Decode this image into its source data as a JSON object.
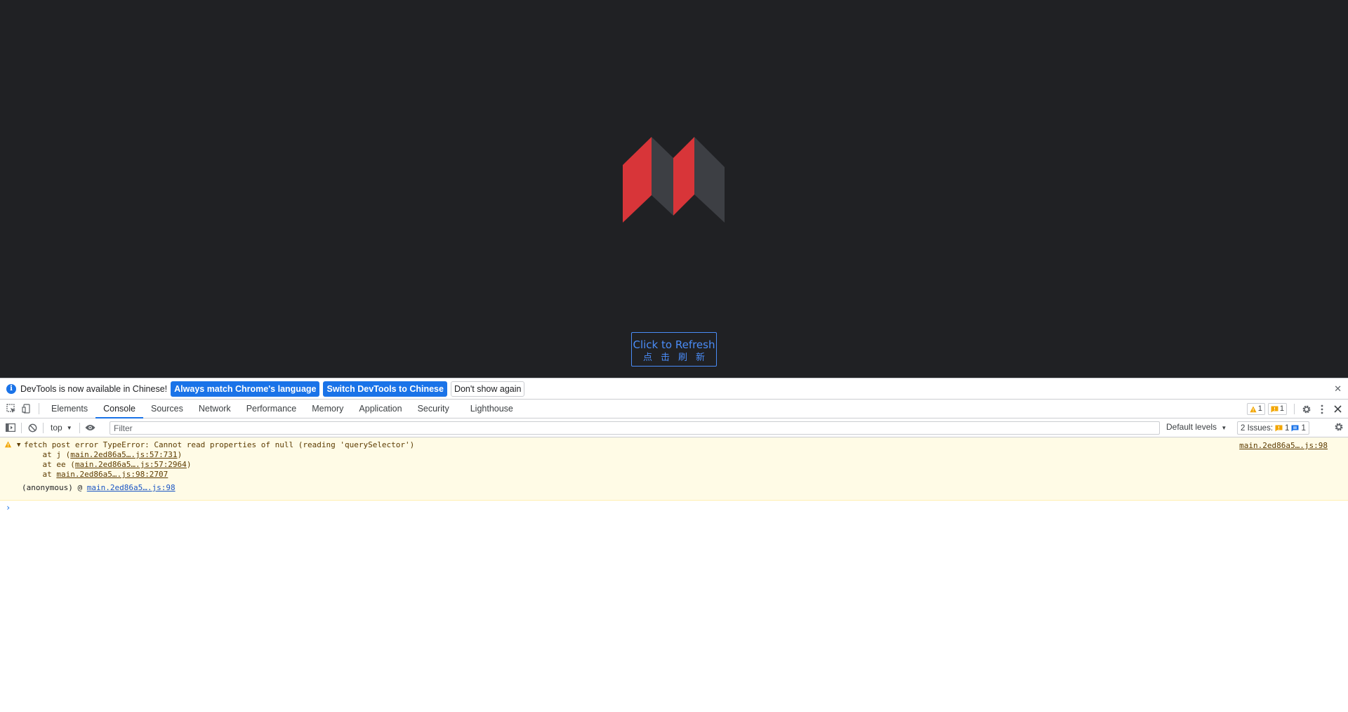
{
  "page": {
    "refresh_button": {
      "label_en": "Click to Refresh",
      "label_zh": "点击刷新"
    },
    "colors": {
      "background": "#202124",
      "logo_red": "#d83539",
      "logo_gray": "#3d3f44",
      "accent": "#4a8cf7"
    }
  },
  "infobar": {
    "message": "DevTools is now available in Chinese!",
    "btn_match": "Always match Chrome's language",
    "btn_switch": "Switch DevTools to Chinese",
    "btn_dismiss": "Don't show again"
  },
  "tabs": [
    {
      "label": "Elements"
    },
    {
      "label": "Console",
      "active": true
    },
    {
      "label": "Sources"
    },
    {
      "label": "Network"
    },
    {
      "label": "Performance"
    },
    {
      "label": "Memory"
    },
    {
      "label": "Application"
    },
    {
      "label": "Security"
    },
    {
      "label": "Lighthouse"
    }
  ],
  "tabbar_right": {
    "warnings_count": "1",
    "errors_count": "1"
  },
  "toolbar": {
    "context": "top",
    "filter_placeholder": "Filter",
    "levels": "Default levels",
    "issues_label": "2 Issues:",
    "issues_warn": "1",
    "issues_info": "1"
  },
  "console": {
    "warning": {
      "message": "fetch post error TypeError: Cannot read properties of null (reading 'querySelector')",
      "stack_prefix_1": "    at j (",
      "stack_link_1": "main.2ed86a5….js:57:731",
      "stack_suffix_1": ")",
      "stack_prefix_2": "    at ee (",
      "stack_link_2": "main.2ed86a5….js:57:2964",
      "stack_suffix_2": ")",
      "stack_prefix_3": "    at ",
      "stack_link_3": "main.2ed86a5….js:98:2707",
      "anon_label": "(anonymous)",
      "anon_at": " @ ",
      "anon_link": "main.2ed86a5….js:98",
      "source": "main.2ed86a5….js:98"
    },
    "prompt_glyph": "›"
  }
}
